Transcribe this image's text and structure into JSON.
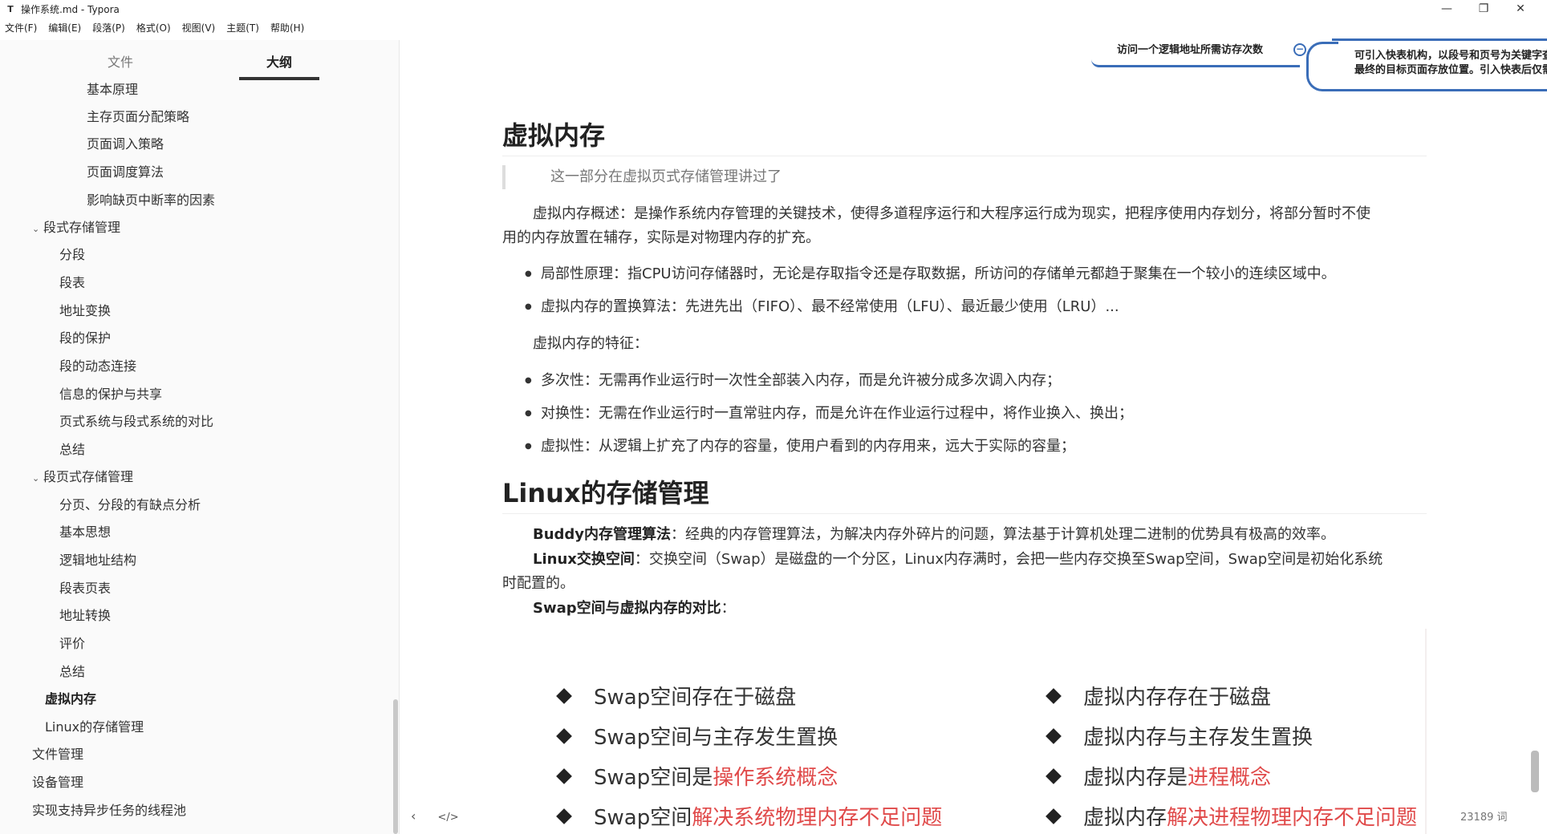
{
  "window": {
    "title": "操作系统.md - Typora",
    "minimize": "—",
    "maximize": "❐",
    "close": "✕"
  },
  "menu": [
    "文件(F)",
    "编辑(E)",
    "段落(P)",
    "格式(O)",
    "视图(V)",
    "主题(T)",
    "帮助(H)"
  ],
  "sidebar": {
    "tab_files": "文件",
    "tab_outline": "大纲",
    "items": [
      {
        "label": "基本原理"
      },
      {
        "label": "主存页面分配策略"
      },
      {
        "label": "页面调入策略"
      },
      {
        "label": "页面调度算法"
      },
      {
        "label": "影响缺页中断率的因素"
      },
      {
        "label": "段式存储管理"
      },
      {
        "label": "分段"
      },
      {
        "label": "段表"
      },
      {
        "label": "地址变换"
      },
      {
        "label": "段的保护"
      },
      {
        "label": "段的动态连接"
      },
      {
        "label": "信息的保护与共享"
      },
      {
        "label": "页式系统与段式系统的对比"
      },
      {
        "label": "总结"
      },
      {
        "label": "段页式存储管理"
      },
      {
        "label": "分页、分段的有缺点分析"
      },
      {
        "label": "基本思想"
      },
      {
        "label": "逻辑地址结构"
      },
      {
        "label": "段表页表"
      },
      {
        "label": "地址转换"
      },
      {
        "label": "评价"
      },
      {
        "label": "总结"
      },
      {
        "label": "虚拟内存"
      },
      {
        "label": "Linux的存储管理"
      },
      {
        "label": "文件管理"
      },
      {
        "label": "设备管理"
      },
      {
        "label": "实现支持异步任务的线程池"
      }
    ]
  },
  "mindmap": {
    "left_node": "访问一个逻辑地址所需访存次数",
    "right_line1": "可引入快表机构，以段号和页号为关键字查询快表，即可直接找到",
    "right_line2": "最终的目标页面存放位置。引入快表后仅需一次访存",
    "toggle": "−"
  },
  "doc": {
    "h1_vm": "虚拟内存",
    "quote": "这一部分在虚拟页式存储管理讲过了",
    "vm_overview_1": "虚拟内存概述：是操作系统内存管理的关键技术，使得多道程序运行和大程序运行成为现实，把程序使用内存划分，将部分暂时不使",
    "vm_overview_2": "用的内存放置在辅存，实际是对物理内存的扩充。",
    "bullet_locality": "局部性原理：指CPU访问存储器时，无论是存取指令还是存取数据，所访问的存储单元都趋于聚集在一个较小的连续区域中。",
    "bullet_replace": "虚拟内存的置换算法：先进先出（FIFO）、最不经常使用（LFU）、最近最少使用（LRU）...",
    "features": "虚拟内存的特征：",
    "bullet_multi": "多次性：无需再作业运行时一次性全部装入内存，而是允许被分成多次调入内存；",
    "bullet_swap": "对换性：无需在作业运行时一直常驻内存，而是允许在作业运行过程中，将作业换入、换出；",
    "bullet_virtual": "虚拟性：从逻辑上扩充了内存的容量，使用户看到的内存用来，远大于实际的容量；",
    "h1_linux": "Linux的存储管理",
    "buddy_label": "Buddy内存管理算法",
    "buddy_text": "：经典的内存管理算法，为解决内存外碎片的问题，算法基于计算机处理二进制的优势具有极高的效率。",
    "swap_label": "Linux交换空间",
    "swap_text_1": "：交换空间（Swap）是磁盘的一个分区，Linux内存满时，会把一些内存交换至Swap空间，Swap空间是初始化系统",
    "swap_text_2": "时配置的。",
    "compare_label": "Swap空间与虚拟内存的对比",
    "compare_colon": "："
  },
  "compare": {
    "left": [
      {
        "plain": "Swap空间存在于磁盘",
        "red": ""
      },
      {
        "plain": "Swap空间与主存发生置换",
        "red": ""
      },
      {
        "plain": "Swap空间是",
        "red": "操作系统概念"
      },
      {
        "plain": "Swap空间",
        "red": "解决系统物理内存不足问题"
      }
    ],
    "right": [
      {
        "plain": "虚拟内存存在于磁盘",
        "red": ""
      },
      {
        "plain": "虚拟内存与主存发生置换",
        "red": ""
      },
      {
        "plain": "虚拟内存是",
        "red": "进程概念"
      },
      {
        "plain": "虚拟内存",
        "red": "解决进程物理内存不足问题"
      }
    ]
  },
  "footer": {
    "left_icon": "‹",
    "code_icon": "</>",
    "wordcount": "23189 词"
  }
}
